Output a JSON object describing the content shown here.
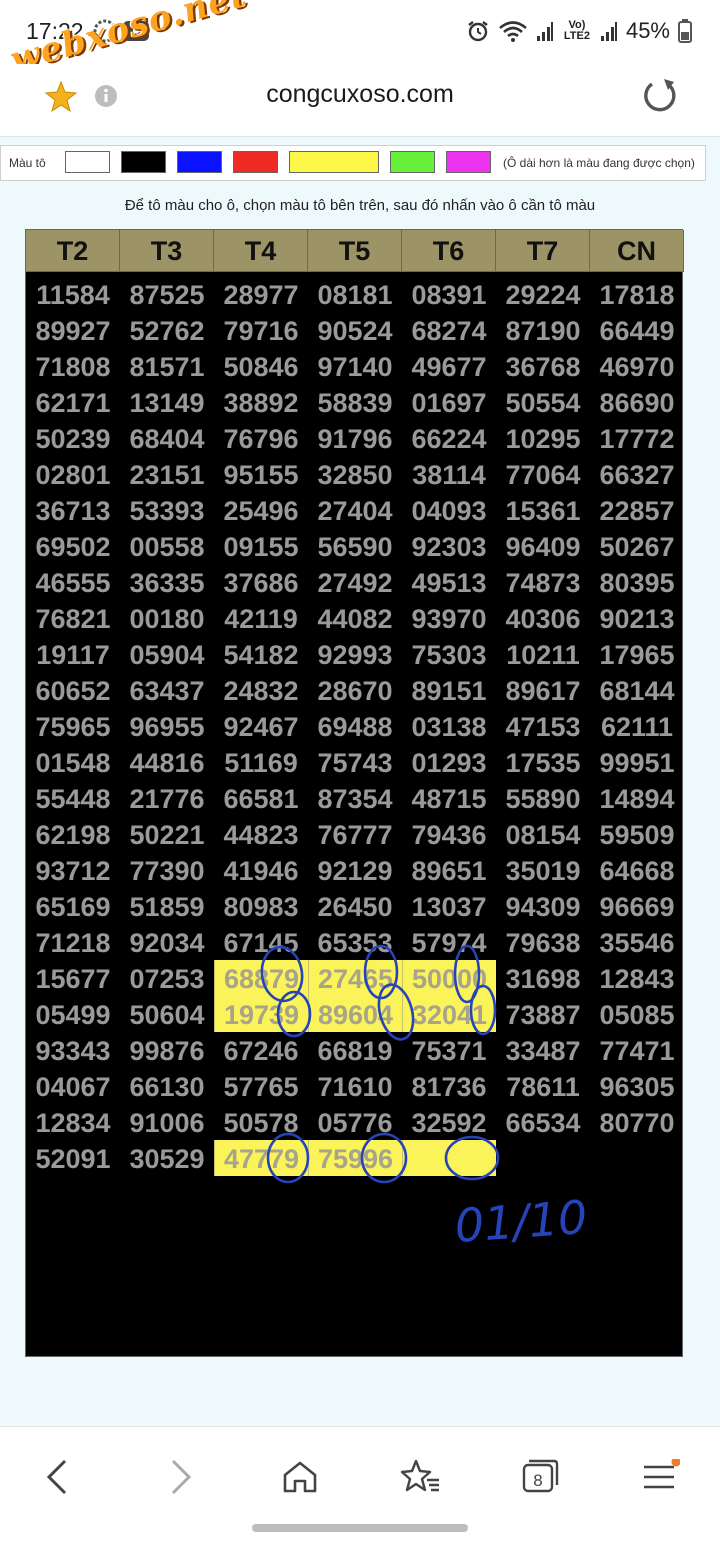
{
  "status_bar": {
    "time": "17:22",
    "network": "Vo) LTE2",
    "battery": "45%"
  },
  "browser": {
    "domain": "congcuxoso.com",
    "tab_count": "8"
  },
  "watermark": "webxoso.net",
  "palette": {
    "label": "Màu tô",
    "colors": [
      "#ffffff",
      "#000000",
      "#0a12ff",
      "#ee2a22",
      "#fdf74a",
      "#66f03a",
      "#ee33ee"
    ],
    "note": "(Ô dài hơn là màu đang được chọn)"
  },
  "instruction": "Để tô màu cho ô, chọn màu tô bên trên, sau đó nhấn vào ô cần tô màu",
  "board": {
    "headers": [
      "T2",
      "T3",
      "T4",
      "T5",
      "T6",
      "T7",
      "CN"
    ],
    "rows": [
      [
        "11584",
        "87525",
        "28977",
        "08181",
        "08391",
        "29224",
        "17818"
      ],
      [
        "89927",
        "52762",
        "79716",
        "90524",
        "68274",
        "87190",
        "66449"
      ],
      [
        "71808",
        "81571",
        "50846",
        "97140",
        "49677",
        "36768",
        "46970"
      ],
      [
        "62171",
        "13149",
        "38892",
        "58839",
        "01697",
        "50554",
        "86690"
      ],
      [
        "50239",
        "68404",
        "76796",
        "91796",
        "66224",
        "10295",
        "17772"
      ],
      [
        "02801",
        "23151",
        "95155",
        "32850",
        "38114",
        "77064",
        "66327"
      ],
      [
        "36713",
        "53393",
        "25496",
        "27404",
        "04093",
        "15361",
        "22857"
      ],
      [
        "69502",
        "00558",
        "09155",
        "56590",
        "92303",
        "96409",
        "50267"
      ],
      [
        "46555",
        "36335",
        "37686",
        "27492",
        "49513",
        "74873",
        "80395"
      ],
      [
        "76821",
        "00180",
        "42119",
        "44082",
        "93970",
        "40306",
        "90213"
      ],
      [
        "19117",
        "05904",
        "54182",
        "92993",
        "75303",
        "10211",
        "17965"
      ],
      [
        "60652",
        "63437",
        "24832",
        "28670",
        "89151",
        "89617",
        "68144"
      ],
      [
        "75965",
        "96955",
        "92467",
        "69488",
        "03138",
        "47153",
        "62111"
      ],
      [
        "01548",
        "44816",
        "51169",
        "75743",
        "01293",
        "17535",
        "99951"
      ],
      [
        "55448",
        "21776",
        "66581",
        "87354",
        "48715",
        "55890",
        "14894"
      ],
      [
        "62198",
        "50221",
        "44823",
        "76777",
        "79436",
        "08154",
        "59509"
      ],
      [
        "93712",
        "77390",
        "41946",
        "92129",
        "89651",
        "35019",
        "64668"
      ],
      [
        "65169",
        "51859",
        "80983",
        "26450",
        "13037",
        "94309",
        "96669"
      ],
      [
        "71218",
        "92034",
        "67145",
        "65353",
        "57974",
        "79638",
        "35546"
      ],
      [
        "15677",
        "07253",
        "68879",
        "27465",
        "50000",
        "31698",
        "12843"
      ],
      [
        "05499",
        "50604",
        "19739",
        "89604",
        "32041",
        "73887",
        "05085"
      ],
      [
        "93343",
        "99876",
        "67246",
        "66819",
        "75371",
        "33487",
        "77471"
      ],
      [
        "04067",
        "66130",
        "57765",
        "71610",
        "81736",
        "78611",
        "96305"
      ],
      [
        "12834",
        "91006",
        "50578",
        "05776",
        "32592",
        "66534",
        "80770"
      ],
      [
        "52091",
        "30529",
        "47779",
        "75996",
        "",
        "",
        ""
      ]
    ],
    "highlighted_cells": [
      [
        19,
        2
      ],
      [
        19,
        3
      ],
      [
        19,
        4
      ],
      [
        20,
        2
      ],
      [
        20,
        3
      ],
      [
        20,
        4
      ],
      [
        24,
        2
      ],
      [
        24,
        3
      ],
      [
        24,
        4
      ]
    ],
    "highlight_color": "#fbf35a"
  },
  "annotation": {
    "handwritten_text": "01/10",
    "ink_color": "#2743b8"
  }
}
